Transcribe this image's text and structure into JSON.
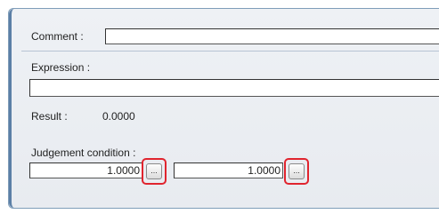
{
  "comment": {
    "label": "Comment :",
    "value": ""
  },
  "expression": {
    "label": "Expression :",
    "value": ""
  },
  "result": {
    "label": "Result :",
    "value": "0.0000"
  },
  "judgement": {
    "label": "Judgement condition :",
    "lower_value": "1.0000",
    "upper_value": "1.0000",
    "button_label": "..."
  },
  "colors": {
    "highlight": "#e0242e",
    "panel_border": "#7f9db9"
  }
}
